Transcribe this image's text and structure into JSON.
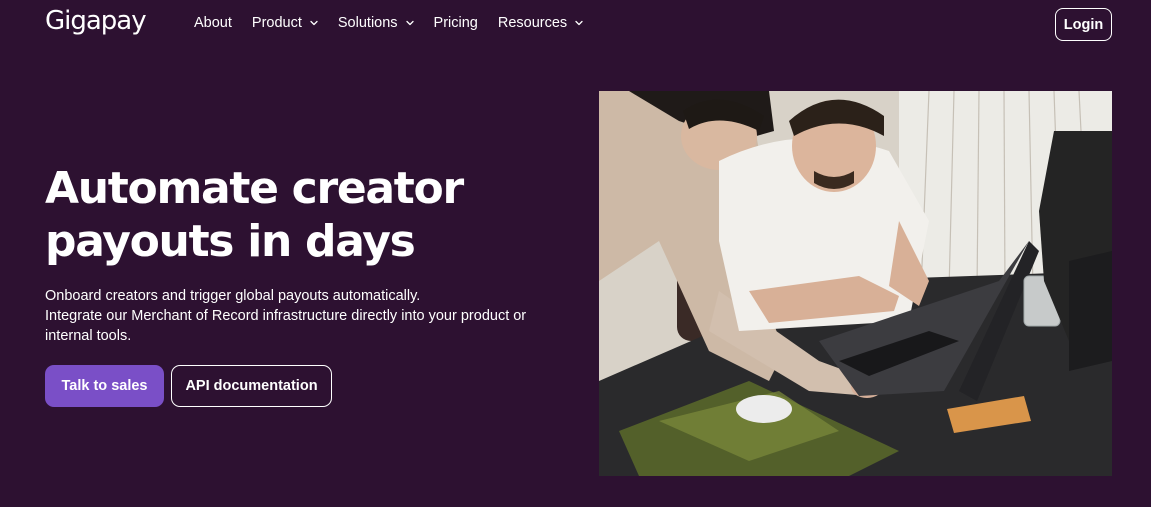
{
  "header": {
    "logo": "Gigapay",
    "nav": [
      {
        "label": "About",
        "has_dropdown": false
      },
      {
        "label": "Product",
        "has_dropdown": true
      },
      {
        "label": "Solutions",
        "has_dropdown": true
      },
      {
        "label": "Pricing",
        "has_dropdown": false
      },
      {
        "label": "Resources",
        "has_dropdown": true
      }
    ],
    "login_label": "Login"
  },
  "hero": {
    "headline_line1": "Automate creator",
    "headline_line2": "payouts in days",
    "subtext_line1": "Onboard creators and trigger global payouts automatically.",
    "subtext_line2": "Integrate our Merchant of Record infrastructure directly into your product or internal tools.",
    "primary_cta": "Talk to sales",
    "secondary_cta": "API documentation"
  },
  "colors": {
    "background": "#2d1131",
    "accent": "#7a4fc7",
    "text": "#ffffff"
  },
  "icons": {
    "dropdown": "chevron-down-icon"
  }
}
